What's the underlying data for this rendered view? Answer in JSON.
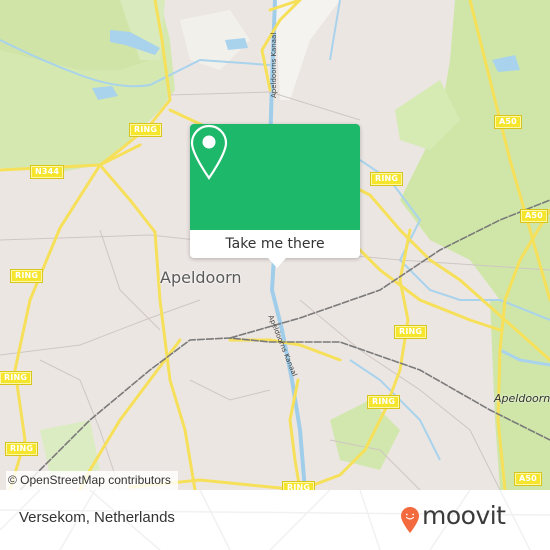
{
  "map": {
    "city_label": "Apeldoorn",
    "district_label": "Apeldoorn",
    "canal_labels": [
      "Apeldoorns Kanaal",
      "Apeldoorns Kanaal"
    ],
    "road_shields": [
      {
        "label": "RING"
      },
      {
        "label": "N344"
      },
      {
        "label": "RING"
      },
      {
        "label": "RING"
      },
      {
        "label": "RING"
      },
      {
        "label": "RING"
      },
      {
        "label": "RING"
      },
      {
        "label": "RING"
      },
      {
        "label": "RING"
      },
      {
        "label": "RING"
      },
      {
        "label": "A50"
      },
      {
        "label": "A50"
      },
      {
        "label": "A50"
      }
    ],
    "attribution": "© OpenStreetMap contributors",
    "colors": {
      "land": "#ece6e3",
      "park": "#cfe6a8",
      "water": "#a9d3ec",
      "road_major": "#f6e05a",
      "rail": "#777777"
    }
  },
  "popup": {
    "icon": "map-pin-icon",
    "label": "Take me there",
    "color": "#1eb86b"
  },
  "footer": {
    "place_name": "Versekom, Netherlands",
    "brand": {
      "icon": "moovit-pin-icon",
      "name": "moovit",
      "color": "#f26a3d"
    }
  }
}
